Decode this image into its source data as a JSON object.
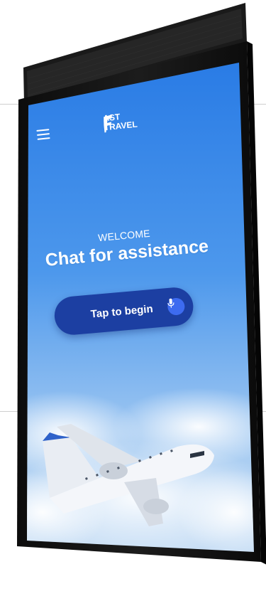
{
  "brand": {
    "line1": "AST",
    "line2": "TRAVEL"
  },
  "header": {
    "menu_icon": "hamburger-menu-icon"
  },
  "hero": {
    "welcome": "WELCOME",
    "headline": "Chat for assistance"
  },
  "cta": {
    "label": "Tap to begin",
    "icon": "microphone-icon"
  },
  "colors": {
    "sky_top": "#1f73e3",
    "sky_bottom": "#dbe9f7",
    "button": "#1c3fa2",
    "mic_bg": "#3d6bf0",
    "bezel": "#141414"
  }
}
